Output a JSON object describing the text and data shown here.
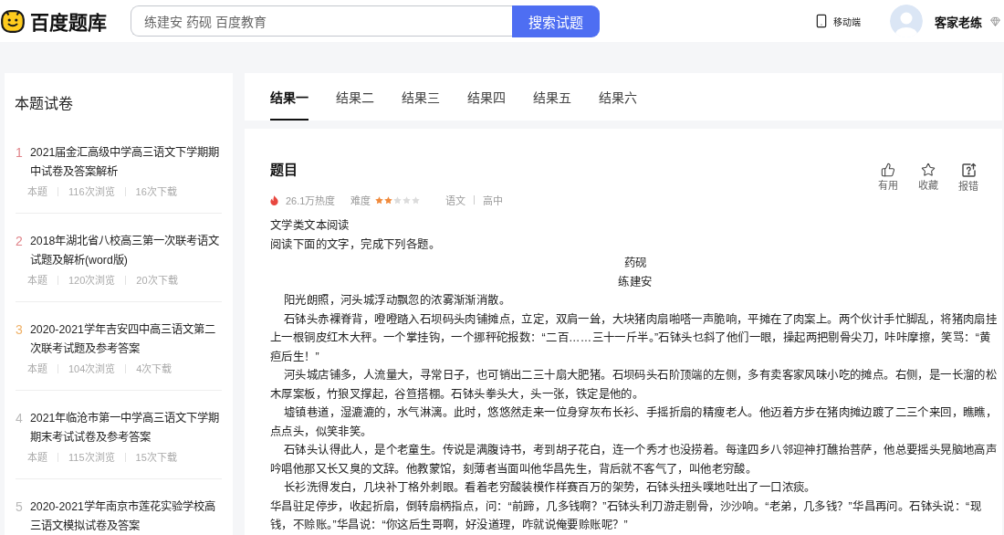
{
  "header": {
    "logo": "百度题库",
    "search": {
      "value": "练建安 药砚 百度教育",
      "button": "搜索试题"
    },
    "mobile_link": "移动端",
    "user_name": "客家老练"
  },
  "sidebar": {
    "title": "本题试卷",
    "papers": [
      {
        "index": "1",
        "color": "#e0848a",
        "title": "2021届金汇高级中学高三语文下学期期中试卷及答案解析",
        "meta": {
          "source": "本题",
          "views": "116次浏览",
          "downloads": "16次下载"
        }
      },
      {
        "index": "2",
        "color": "#e0848a",
        "title": "2018年湖北省八校高三第一次联考语文试题及解析(word版)",
        "meta": {
          "source": "本题",
          "views": "120次浏览",
          "downloads": "20次下载"
        }
      },
      {
        "index": "3",
        "color": "#efb066",
        "title": "2020-2021学年吉安四中高三语文第二次联考试题及参考答案",
        "meta": {
          "source": "本题",
          "views": "104次浏览",
          "downloads": "4次下载"
        }
      },
      {
        "index": "4",
        "color": "#b8b8b8",
        "title": "2021年临沧市第一中学高三语文下学期期末考试试卷及参考答案",
        "meta": {
          "source": "本题",
          "views": "115次浏览",
          "downloads": "15次下载"
        }
      },
      {
        "index": "5",
        "color": "#b8b8b8",
        "title": "2020-2021学年南京市莲花实验学校高三语文模拟试卷及答案"
      }
    ]
  },
  "tabs": [
    {
      "label": "结果一",
      "selected": true
    },
    {
      "label": "结果二",
      "selected": false
    },
    {
      "label": "结果三",
      "selected": false
    },
    {
      "label": "结果四",
      "selected": false
    },
    {
      "label": "结果五",
      "selected": false
    },
    {
      "label": "结果六",
      "selected": false
    }
  ],
  "question": {
    "title": "题目",
    "heat": "26.1万热度",
    "difficulty_label": "难度",
    "stars": 2,
    "subject": "语文",
    "grade": "高中",
    "actions": [
      {
        "kind": "useful",
        "label": "有用"
      },
      {
        "kind": "favorite",
        "label": "收藏"
      },
      {
        "kind": "report",
        "label": "报错"
      }
    ],
    "body": [
      {
        "kind": "line",
        "text": "文学类文本阅读"
      },
      {
        "kind": "line",
        "text": "阅读下面的文字，完成下列各题。"
      },
      {
        "kind": "title",
        "text": "药砚"
      },
      {
        "kind": "author",
        "text": "练建安"
      },
      {
        "kind": "paragraph",
        "text": "阳光朗照，河头城浮动飘忽的浓雾渐渐消散。"
      },
      {
        "kind": "paragraph",
        "text": "石钵头赤裸脊背，噔噔踏入石坝码头肉铺摊点，立定，双肩一耸，大块猪肉扇啪嗒一声脆响，平摊在了肉案上。两个伙计手忙脚乱，将猪肉扇挂上一根铜皮红木大秤。一个掌挂钩，一个挪秤砣报数：“二百……三十一斤半。”石钵头乜斜了他们一眼，操起两把剔骨尖刀，咔咔摩擦，笑骂：“黄疸后生！”"
      },
      {
        "kind": "paragraph",
        "text": "河头城店铺多，人流量大，寻常日子，也可销出二三十扇大肥猪。石坝码头石阶顶端的左侧，多有卖客家风味小吃的摊点。右侧，是一长溜的松木厚案板，竹狼叉撑起，谷笪搭棚。石钵头拳头大，头一张，铁定是他的。"
      },
      {
        "kind": "paragraph",
        "text": "墟镇巷道，湿漉漉的，水气淋漓。此时，悠悠然走来一位身穿灰布长衫、手摇折扇的精瘦老人。他迈着方步在猪肉摊边踱了二三个来回，瞧瞧，点点头，似笑非笑。"
      },
      {
        "kind": "paragraph",
        "text": "石钵头认得此人，是个老童生。传说是满腹诗书，考到胡子花白，连一个秀才也没捞着。每逢四乡八邻迎神打醮抬菩萨，他总要摇头晃脑地高声吟唱他那又长又臭的文辞。他教蒙馆，刻薄者当面叫他华昌先生，背后就不客气了，叫他老穷酸。"
      },
      {
        "kind": "paragraph",
        "text": "长衫洗得发白，几块补丁格外刺眼。看着老穷酸装模作样赛百万的架势，石钵头扭头噗地吐出了一口浓痰。"
      },
      {
        "kind": "line",
        "text": "华昌驻足停步，收起折扇，倒转扇柄指点，问：“前蹄，几多钱啊？”石钵头利刀游走剔骨，沙沙响。“老弟，几多钱？”华昌再问。石钵头说：“现钱，不赊账。”华昌说：“你这后生哥啊，好没道理，咋就说俺要赊账呢？”"
      }
    ]
  }
}
